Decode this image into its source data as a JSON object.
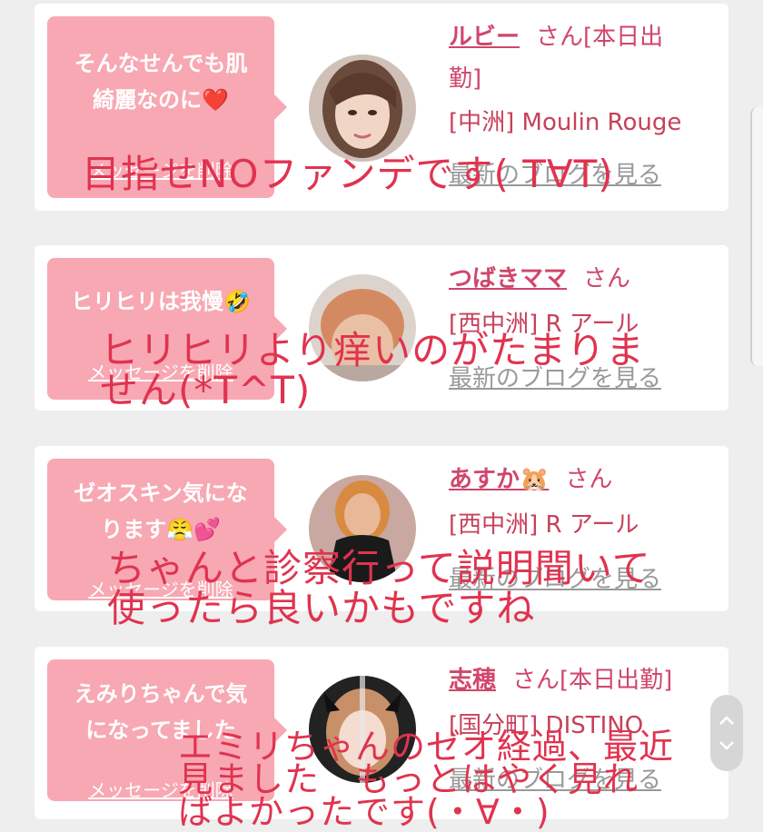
{
  "cards": [
    {
      "bubble_line1": "そんなせんでも肌",
      "bubble_line2": "綺麗なのに❤️",
      "delete_label": "メッセージを削除",
      "name": "ルビー",
      "san": "さん[本日出",
      "san2": "勤]",
      "shop": "[中洲] Moulin Rouge",
      "blog_link": "最新のブログを見る"
    },
    {
      "bubble_line1": "ヒリヒリは我慢🤣",
      "bubble_line2": "",
      "delete_label": "メッセージを削除",
      "name": "つばきママ",
      "san": "さん",
      "san2": "",
      "shop": "[西中洲] R アール",
      "blog_link": "最新のブログを見る"
    },
    {
      "bubble_line1": "ゼオスキン気にな",
      "bubble_line2": "ります😤💕",
      "delete_label": "メッセージを削除",
      "name": "あすか🐹",
      "san": "さん",
      "san2": "",
      "shop": "[西中洲] R アール",
      "blog_link": "最新のブログを見る"
    },
    {
      "bubble_line1": "えみりちゃんで気",
      "bubble_line2": "になってました",
      "delete_label": "メッセージを削除",
      "name": "志穂",
      "san": "さん[本日出勤]",
      "san2": "",
      "shop": "[国分町] DISTINO",
      "blog_link": "最新のブログを見る"
    }
  ],
  "overlays": [
    "目指せNOファンデです( T∀T)",
    "ヒリヒリより痒いのがたまりま\nせん(*T^T)",
    "ちゃんと診察行って説明聞いて\n使ったら良いかもですね",
    "エミリちゃんのゼオ経過、最近\n見ました　もっとはやく見れ\nばよかったです(・∀・)"
  ],
  "colors": {
    "bubble": "#f7a8b3",
    "name": "#d0466a",
    "overlay_text": "#e0334f",
    "background": "#eeeeee"
  },
  "icons": [
    "chevron-up-icon",
    "chevron-down-icon"
  ]
}
